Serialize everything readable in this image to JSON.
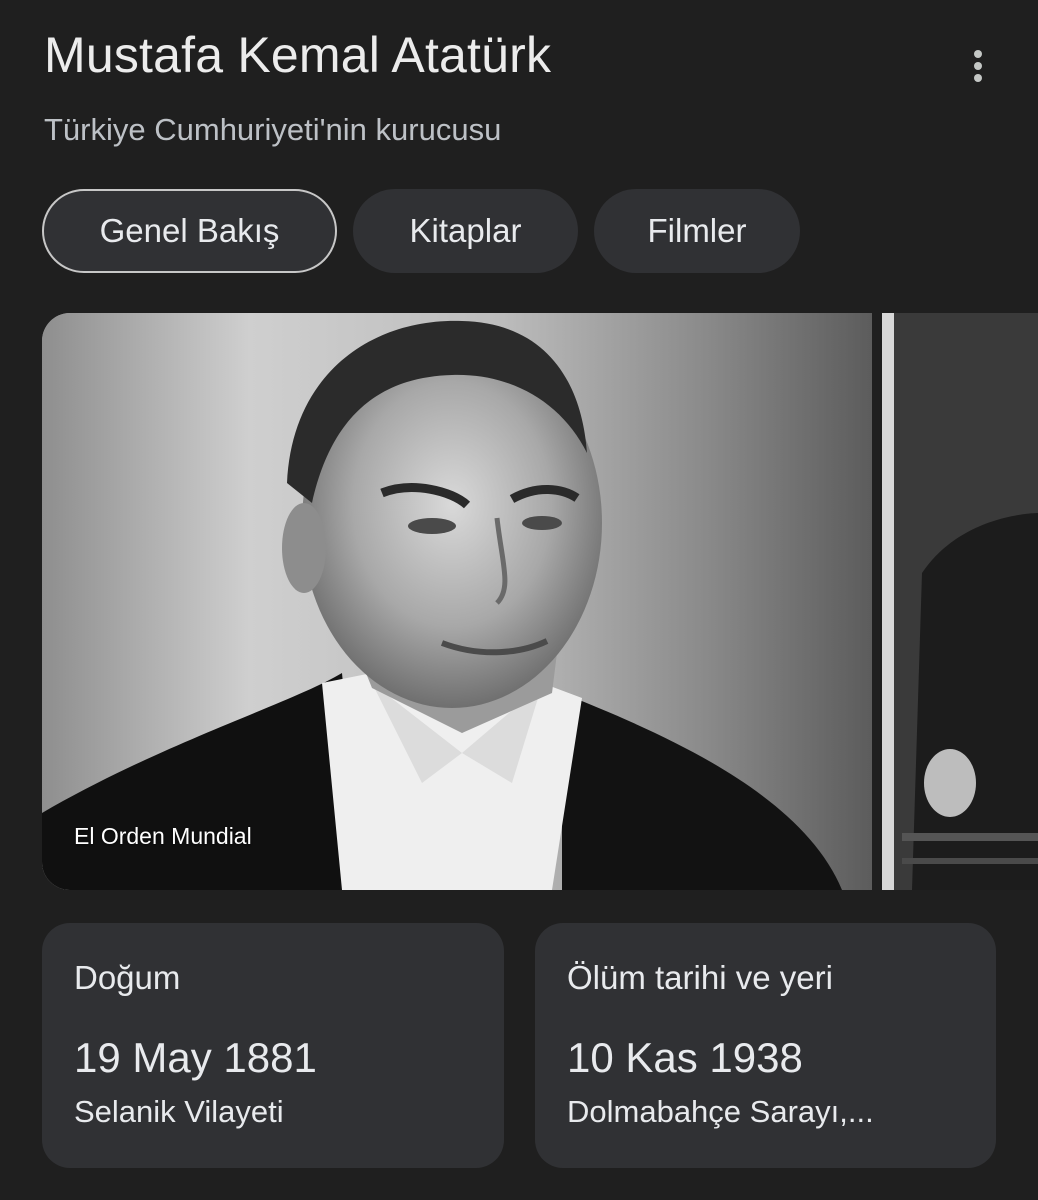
{
  "header": {
    "title": "Mustafa Kemal Atatürk",
    "subtitle": "Türkiye Cumhuriyeti'nin kurucusu",
    "more_icon": "more-vert-icon"
  },
  "tabs": [
    {
      "label": "Genel Bakış",
      "active": true
    },
    {
      "label": "Kitaplar",
      "active": false
    },
    {
      "label": "Filmler",
      "active": false
    }
  ],
  "images": {
    "main_caption": "El Orden Mundial"
  },
  "facts": [
    {
      "label": "Doğum",
      "date": "19 May 1881",
      "place": "Selanik Vilayeti"
    },
    {
      "label": "Ölüm tarihi ve yeri",
      "date": "10 Kas 1938",
      "place": "Dolmabahçe Sarayı,..."
    }
  ],
  "colors": {
    "background": "#1f1f1f",
    "chip_bg": "#303134",
    "card_bg": "#303134",
    "active_chip_border": "#c7c7c7",
    "text_primary": "#e8eaed",
    "text_secondary": "#bdc1c6"
  }
}
